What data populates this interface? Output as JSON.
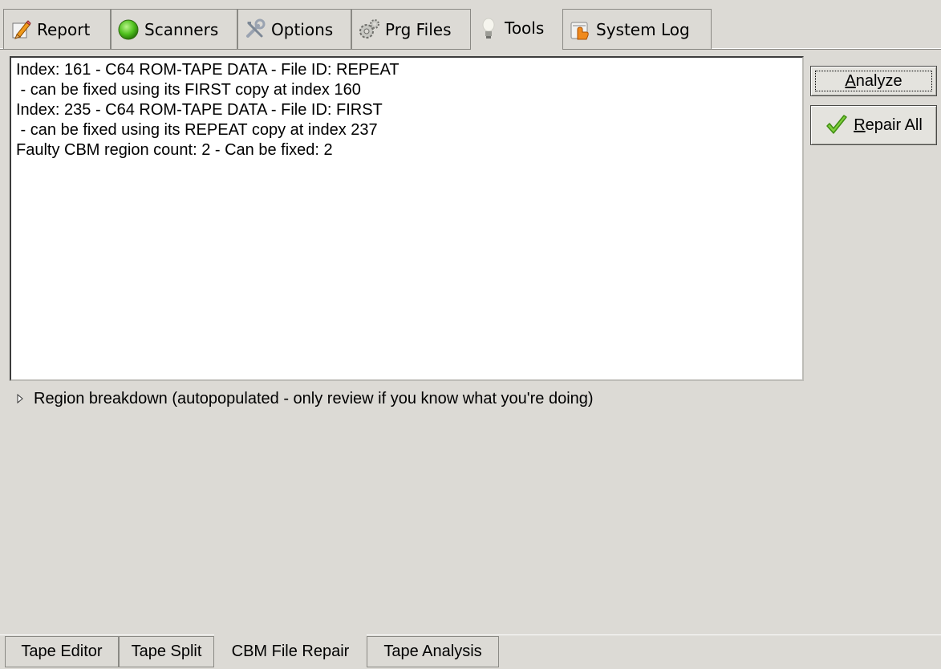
{
  "top_tabs": [
    {
      "label": "Report",
      "icon": "pencil-icon"
    },
    {
      "label": "Scanners",
      "icon": "green-circle-icon"
    },
    {
      "label": "Options",
      "icon": "tools-icon"
    },
    {
      "label": "Prg Files",
      "icon": "gears-icon"
    },
    {
      "label": "Tools",
      "icon": "lightbulb-icon"
    },
    {
      "label": "System Log",
      "icon": "log-icon"
    }
  ],
  "active_top_tab": "Tools",
  "log": {
    "lines": [
      "Index: 161 - C64 ROM-TAPE DATA - File ID: REPEAT",
      " - can be fixed using its FIRST copy at index 160",
      "Index: 235 - C64 ROM-TAPE DATA - File ID: FIRST",
      " - can be fixed using its REPEAT copy at index 237",
      "Faulty CBM region count: 2 - Can be fixed: 2"
    ]
  },
  "buttons": {
    "analyze_prefix": "A",
    "analyze_rest": "nalyze",
    "repair_prefix": "R",
    "repair_rest": "epair All"
  },
  "expander": {
    "label": "Region breakdown (autopopulated - only review if you know what you're doing)"
  },
  "bottom_tabs": [
    {
      "label": "Tape Editor"
    },
    {
      "label": "Tape Split"
    },
    {
      "label": "CBM File Repair"
    },
    {
      "label": "Tape Analysis"
    }
  ],
  "active_bottom_tab": "CBM File Repair",
  "colors": {
    "background": "#dcdad5",
    "panel": "#ffffff",
    "check_green": "#6fbf2f"
  }
}
